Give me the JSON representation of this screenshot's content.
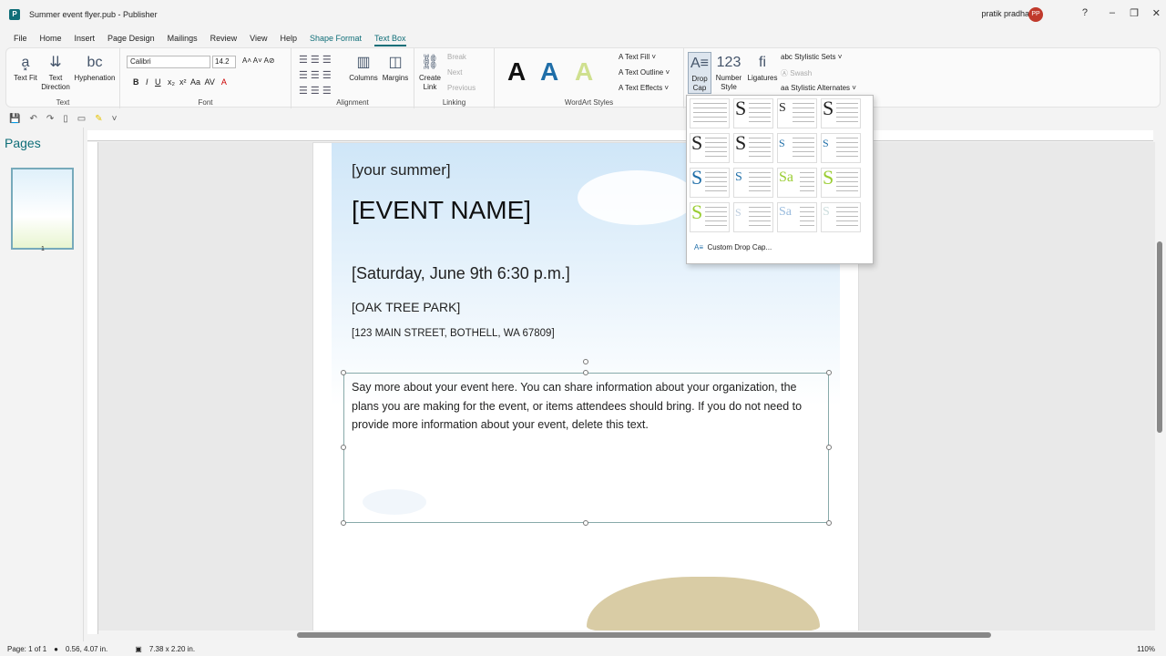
{
  "window": {
    "title": "Summer event flyer.pub  -  Publisher",
    "user": "pratik pradhan",
    "initials": "PP"
  },
  "menu": [
    "File",
    "Home",
    "Insert",
    "Page Design",
    "Mailings",
    "Review",
    "View",
    "Help",
    "Shape Format",
    "Text Box"
  ],
  "ribbon": {
    "text_fit": "Text Fit",
    "text_direction": "Text Direction",
    "hyphenation": "Hyphenation",
    "text_group": "Text",
    "font_name": "Calibri",
    "font_size": "14.2",
    "font_group": "Font",
    "alignment_group": "Alignment",
    "columns": "Columns",
    "margins": "Margins",
    "create_link": "Create Link",
    "break": "Break",
    "next": "Next",
    "previous": "Previous",
    "linking_group": "Linking",
    "wordart_group": "WordArt Styles",
    "text_fill": "Text Fill",
    "text_outline": "Text Outline",
    "text_effects": "Text Effects",
    "drop_cap": "Drop Cap",
    "number_style": "Number Style",
    "ligatures": "Ligatures",
    "stylistic_sets": "Stylistic Sets",
    "swash": "Swash",
    "stylistic_alternates": "Stylistic Alternates"
  },
  "pages_pane": {
    "title": "Pages",
    "page_number": "1"
  },
  "flyer": {
    "line1": "[your summer]",
    "event_name": "[EVENT NAME]",
    "date": "[Saturday, June 9th 6:30 p.m.]",
    "venue": "[OAK TREE PARK]",
    "address": "[123 MAIN STREET, BOTHELL, WA 67809]",
    "body": "Say more about your event here. You can share information about your organization, the plans you are making for the event, or items attendees should bring. If you do not need to provide more information about your event, delete this text."
  },
  "dropdown": {
    "custom": "Custom Drop Cap..."
  },
  "status": {
    "page": "Page: 1 of 1",
    "position": "0.56, 4.07 in.",
    "size": "7.38 x  2.20 in.",
    "zoom": "110%"
  },
  "colors": {
    "accent": "#0f6e78"
  }
}
